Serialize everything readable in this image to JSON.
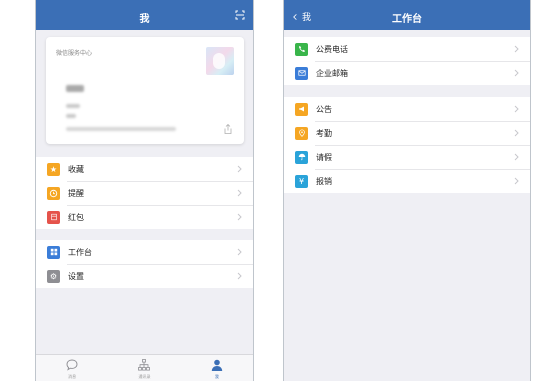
{
  "me_screen": {
    "title": "我",
    "card": {
      "org": "微信服务中心"
    },
    "group1": [
      {
        "label": "收藏",
        "icon": "star-icon",
        "color": "#f5a623"
      },
      {
        "label": "提醒",
        "icon": "clock-icon",
        "color": "#f5a623"
      },
      {
        "label": "红包",
        "icon": "red-envelope-icon",
        "color": "#e5534b"
      }
    ],
    "group2": [
      {
        "label": "工作台",
        "icon": "grid-icon",
        "color": "#3b7dd8"
      },
      {
        "label": "设置",
        "icon": "gear-icon",
        "color": "#8e8e93"
      }
    ],
    "tabbar": [
      {
        "label": "消息",
        "icon": "chat-bubble-icon"
      },
      {
        "label": "通讯录",
        "icon": "org-chart-icon"
      },
      {
        "label": "我",
        "icon": "person-icon",
        "active": true
      }
    ]
  },
  "workbench_screen": {
    "back_label": "我",
    "title": "工作台",
    "group1": [
      {
        "label": "公费电话",
        "icon": "phone-icon",
        "color": "#39b54a"
      },
      {
        "label": "企业邮箱",
        "icon": "mail-icon",
        "color": "#3b7dd8"
      }
    ],
    "group2": [
      {
        "label": "公告",
        "icon": "megaphone-icon",
        "color": "#f5a623"
      },
      {
        "label": "考勤",
        "icon": "location-pin-icon",
        "color": "#f5a623"
      },
      {
        "label": "请假",
        "icon": "umbrella-icon",
        "color": "#2aa3d9"
      },
      {
        "label": "报销",
        "icon": "yen-icon",
        "color": "#2aa3d9"
      }
    ]
  }
}
